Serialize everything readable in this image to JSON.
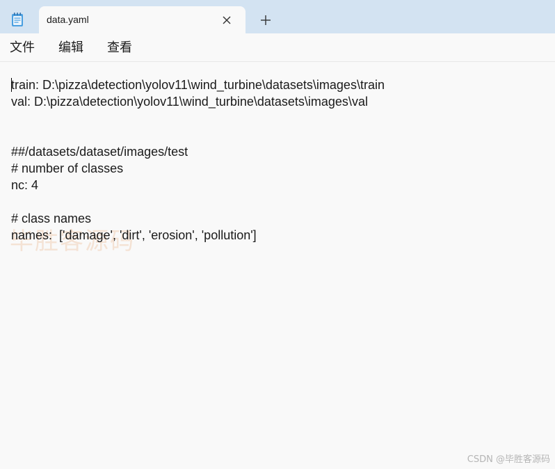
{
  "tab": {
    "title": "data.yaml",
    "close_icon": "close-icon",
    "new_tab_icon": "plus-icon"
  },
  "app_icon": "notepad-icon",
  "menu": {
    "file": "文件",
    "edit": "编辑",
    "view": "查看"
  },
  "editor": {
    "lines": [
      "train: D:\\pizza\\detection\\yolov11\\wind_turbine\\datasets\\images\\train",
      "val: D:\\pizza\\detection\\yolov11\\wind_turbine\\datasets\\images\\val",
      "",
      "",
      "##/datasets/dataset/images/test",
      "# number of classes",
      "nc: 4",
      "",
      "# class names",
      "names:  ['damage', 'dirt', 'erosion', 'pollution']"
    ]
  },
  "watermark": {
    "text": "毕胜客源码",
    "credit": "CSDN @毕胜客源码"
  },
  "colors": {
    "tabstrip": "#d3e3f2",
    "background": "#f9f9f9",
    "text": "#1a1a1a"
  }
}
